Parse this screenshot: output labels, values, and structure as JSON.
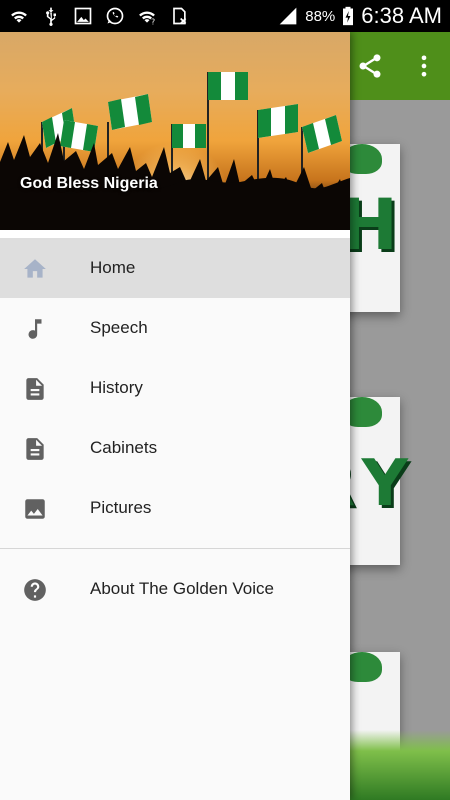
{
  "status_bar": {
    "battery_percent": "88%",
    "time": "6:38 AM",
    "icons": [
      "wifi-icon",
      "usb-icon",
      "gallery-icon",
      "whatsapp-icon",
      "wifi-question-icon",
      "sim-off-icon",
      "signal-icon",
      "battery-charging-icon"
    ]
  },
  "drawer": {
    "header_title": "God Bless Nigeria",
    "items": [
      {
        "label": "Home",
        "icon": "home-icon",
        "active": true
      },
      {
        "label": "Speech",
        "icon": "music-note-icon",
        "active": false
      },
      {
        "label": "History",
        "icon": "document-icon",
        "active": false
      },
      {
        "label": "Cabinets",
        "icon": "document-icon",
        "active": false
      },
      {
        "label": "Pictures",
        "icon": "image-icon",
        "active": false
      }
    ],
    "secondary_items": [
      {
        "label": "About The Golden Voice",
        "icon": "help-icon"
      }
    ]
  },
  "background_app": {
    "actions": [
      "share-icon",
      "overflow-menu-icon"
    ],
    "tile_letters": [
      "H",
      "RY"
    ],
    "accent_color": "#4f8f1a"
  }
}
